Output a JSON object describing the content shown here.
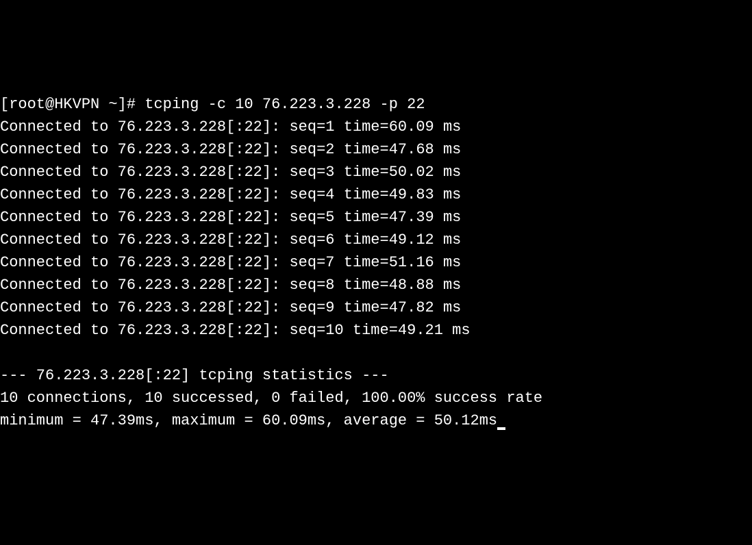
{
  "prompt": {
    "user_host": "[root@HKVPN ~]#",
    "command": "tcping -c 10 76.223.3.228 -p 22"
  },
  "target": {
    "ip": "76.223.3.228",
    "port": "22"
  },
  "results": [
    {
      "prefix": "Connected to",
      "addr": "76.223.3.228[:22]:",
      "seq": "seq=1",
      "time": "time=60.09",
      "unit": "ms"
    },
    {
      "prefix": "Connected to",
      "addr": "76.223.3.228[:22]:",
      "seq": "seq=2",
      "time": "time=47.68",
      "unit": "ms"
    },
    {
      "prefix": "Connected to",
      "addr": "76.223.3.228[:22]:",
      "seq": "seq=3",
      "time": "time=50.02",
      "unit": "ms"
    },
    {
      "prefix": "Connected to",
      "addr": "76.223.3.228[:22]:",
      "seq": "seq=4",
      "time": "time=49.83",
      "unit": "ms"
    },
    {
      "prefix": "Connected to",
      "addr": "76.223.3.228[:22]:",
      "seq": "seq=5",
      "time": "time=47.39",
      "unit": "ms"
    },
    {
      "prefix": "Connected to",
      "addr": "76.223.3.228[:22]:",
      "seq": "seq=6",
      "time": "time=49.12",
      "unit": "ms"
    },
    {
      "prefix": "Connected to",
      "addr": "76.223.3.228[:22]:",
      "seq": "seq=7",
      "time": "time=51.16",
      "unit": "ms"
    },
    {
      "prefix": "Connected to",
      "addr": "76.223.3.228[:22]:",
      "seq": "seq=8",
      "time": "time=48.88",
      "unit": "ms"
    },
    {
      "prefix": "Connected to",
      "addr": "76.223.3.228[:22]:",
      "seq": "seq=9",
      "time": "time=47.82",
      "unit": "ms"
    },
    {
      "prefix": "Connected to",
      "addr": "76.223.3.228[:22]:",
      "seq": "seq=10",
      "time": "time=49.21",
      "unit": "ms"
    }
  ],
  "stats": {
    "header": "--- 76.223.3.228[:22] tcping statistics ---",
    "summary": "10 connections, 10 successed, 0 failed, 100.00% success rate",
    "timing": "minimum = 47.39ms, maximum = 60.09ms, average = 50.12ms"
  }
}
